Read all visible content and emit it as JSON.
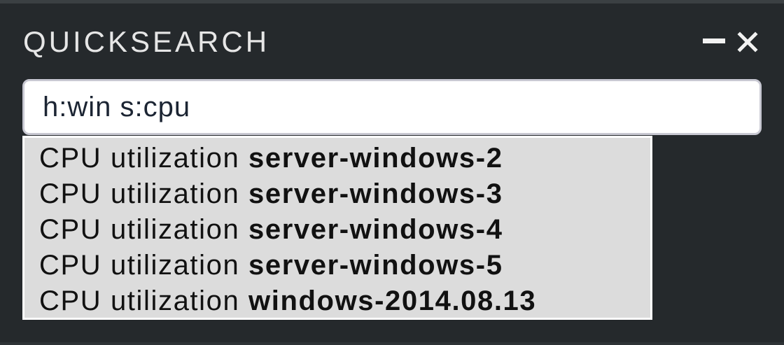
{
  "window": {
    "title": "QUICKSEARCH",
    "minimize_icon": "minimize-icon",
    "close_icon": "close-icon"
  },
  "search": {
    "value": "h:win s:cpu"
  },
  "results": [
    {
      "prefix": "CPU utilization",
      "host": "server-windows-2"
    },
    {
      "prefix": "CPU utilization",
      "host": "server-windows-3"
    },
    {
      "prefix": "CPU utilization",
      "host": "server-windows-4"
    },
    {
      "prefix": "CPU utilization",
      "host": "server-windows-5"
    },
    {
      "prefix": "CPU utilization",
      "host": "windows-2014.08.13"
    }
  ],
  "colors": {
    "background": "#25292c",
    "title_text": "#e6e6e6",
    "dropdown_bg": "#dcdcdc",
    "input_border": "#c8c8d2"
  }
}
